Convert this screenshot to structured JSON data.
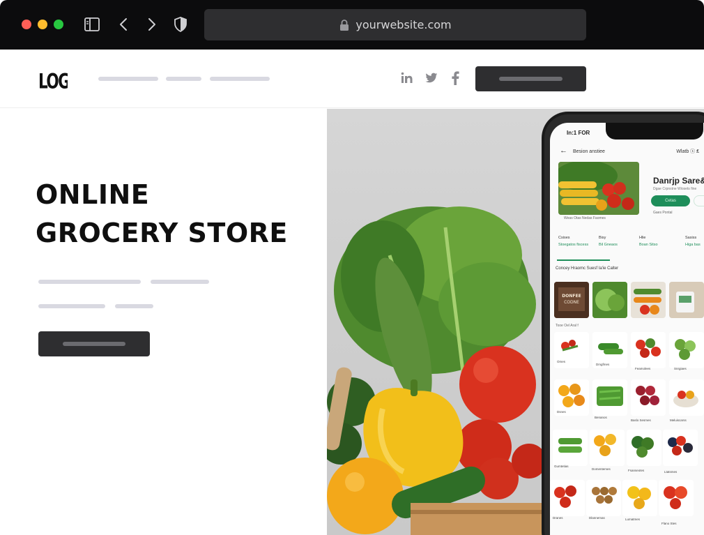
{
  "browser": {
    "url": "yourwebsite.com"
  },
  "header": {
    "logo_text": "LOGO",
    "social": [
      "in",
      "twitter",
      "f"
    ]
  },
  "hero": {
    "title_line1": "ONLINE",
    "title_line2": "GROCERY STORE"
  },
  "phone": {
    "time": "In:1 FOR",
    "topbar_title": "Besion anstiee",
    "topbar_right": "Wlatb ⓢ ₤",
    "store_name": "Danrjp Sare&s",
    "store_sub": "Dgae Crpnstne Wiosets fine",
    "green_button": "Cetas",
    "outline_button": "",
    "banner_caption": "Weas   Otas   Nedas Faomes",
    "store_caption": "Gaes   Pontal",
    "tabs": [
      {
        "label": "Csises",
        "sub": "Stoegatos fiscess"
      },
      {
        "label": "Bisy",
        "sub": "Bil Gneaos"
      },
      {
        "label": "Hlie",
        "sub": "Boan Sitso"
      },
      {
        "label": "Sasiss",
        "sub": "Higa bas"
      }
    ],
    "section_title": "Concey Hraomc  Suesf Ia'ie Calter",
    "row1_label": "Tooe Oel Aral f",
    "first_tile_text": "DONFEE CODNE"
  },
  "colors": {
    "accent_green": "#1e8e5a",
    "chrome_bg": "#0c0c0d",
    "button_dark": "#2e2e30"
  }
}
